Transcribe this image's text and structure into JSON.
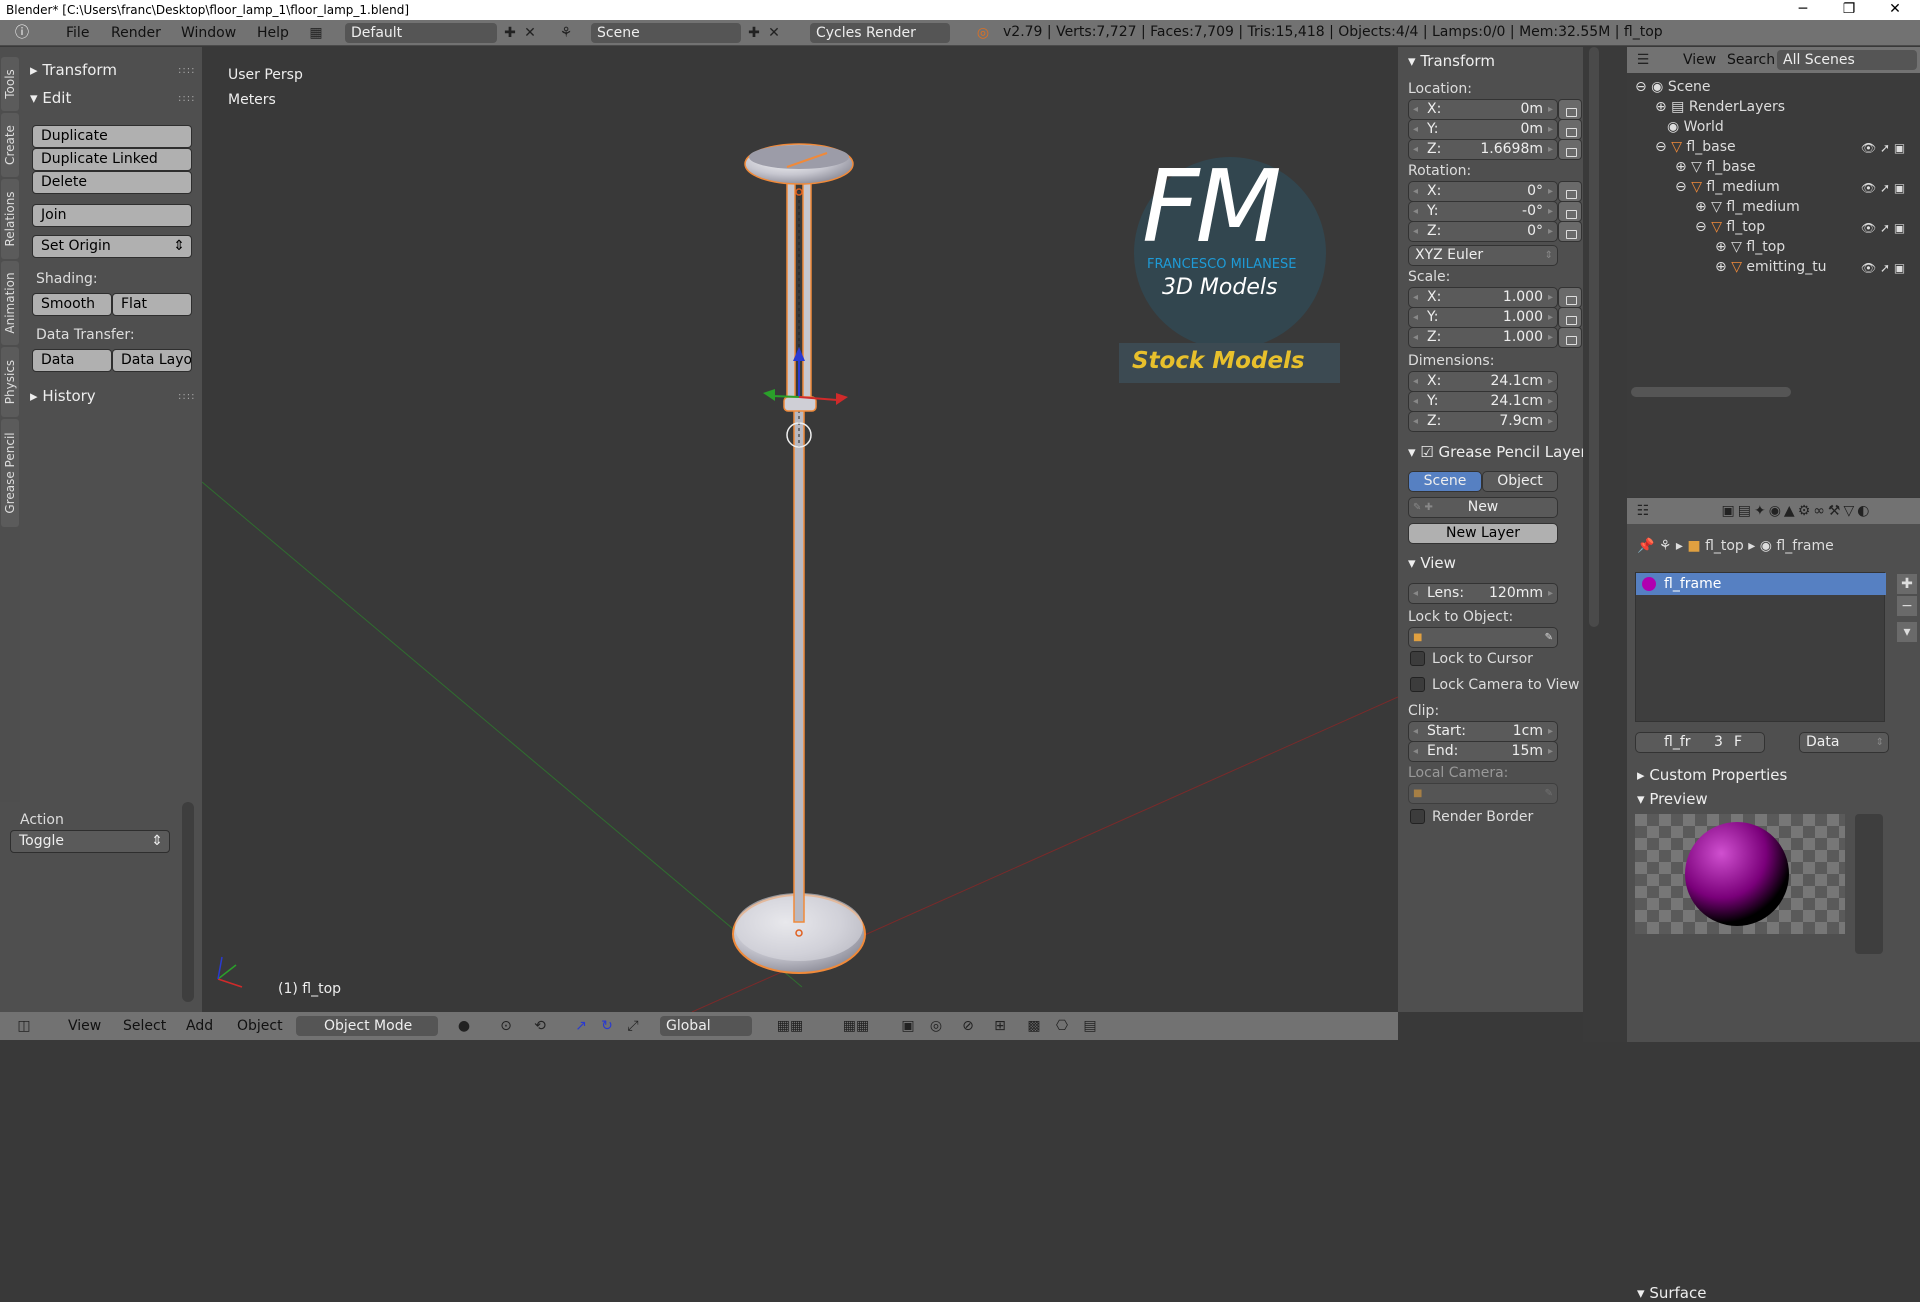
{
  "window": {
    "title": "Blender* [C:\\Users\\franc\\Desktop\\floor_lamp_1\\floor_lamp_1.blend]",
    "minimize": "─",
    "maximize": "❐",
    "close": "✕"
  },
  "topbar": {
    "menus": [
      "File",
      "Render",
      "Window",
      "Help"
    ],
    "layout": "Default",
    "scene": "Scene",
    "engine": "Cycles Render",
    "stats": "v2.79 | Verts:7,727 | Faces:7,709 | Tris:15,418 | Objects:4/4 | Lamps:0/0 | Mem:32.55M | fl_top"
  },
  "lefttabs": [
    "Tools",
    "Create",
    "Relations",
    "Animation",
    "Physics",
    "Grease Pencil"
  ],
  "toolshelf": {
    "transform": "Transform",
    "edit": "Edit",
    "buttons": [
      "Duplicate",
      "Duplicate Linked",
      "Delete"
    ],
    "join": "Join",
    "set_origin": "Set Origin",
    "shading_label": "Shading:",
    "smooth": "Smooth",
    "flat": "Flat",
    "data_transfer_label": "Data Transfer:",
    "data": "Data",
    "data_layo": "Data Layo",
    "history": "History"
  },
  "action": {
    "label": "Action",
    "value": "Toggle"
  },
  "viewport": {
    "view_name": "User Persp",
    "units": "Meters",
    "object_label": "(1) fl_top",
    "logo_letters": "FM",
    "logo_name": "FRANCESCO MILANESE",
    "logo_sub": "3D Models",
    "stock": "Stock Models"
  },
  "bottombar": {
    "view": "View",
    "select": "Select",
    "add": "Add",
    "object": "Object",
    "mode": "Object Mode",
    "orientation": "Global"
  },
  "npanel": {
    "transform": "Transform",
    "location": "Location:",
    "loc": [
      {
        "k": "X:",
        "v": "0m"
      },
      {
        "k": "Y:",
        "v": "0m"
      },
      {
        "k": "Z:",
        "v": "1.6698m"
      }
    ],
    "rotation": "Rotation:",
    "rot": [
      {
        "k": "X:",
        "v": "0°"
      },
      {
        "k": "Y:",
        "v": "-0°"
      },
      {
        "k": "Z:",
        "v": "0°"
      }
    ],
    "euler": "XYZ Euler",
    "scale": "Scale:",
    "scl": [
      {
        "k": "X:",
        "v": "1.000"
      },
      {
        "k": "Y:",
        "v": "1.000"
      },
      {
        "k": "Z:",
        "v": "1.000"
      }
    ],
    "dimensions": "Dimensions:",
    "dim": [
      {
        "k": "X:",
        "v": "24.1cm"
      },
      {
        "k": "Y:",
        "v": "24.1cm"
      },
      {
        "k": "Z:",
        "v": "7.9cm"
      }
    ],
    "gp_layer": "Grease Pencil Layer",
    "scene_btn": "Scene",
    "object_btn": "Object",
    "new_btn": "New",
    "new_layer": "New Layer",
    "view": "View",
    "lens_k": "Lens:",
    "lens_v": "120mm",
    "lock_obj": "Lock to Object:",
    "lock_cursor": "Lock to Cursor",
    "lock_cam": "Lock Camera to View",
    "clip": "Clip:",
    "start_k": "Start:",
    "start_v": "1cm",
    "end_k": "End:",
    "end_v": "15m",
    "local_cam": "Local Camera:",
    "render_border": "Render Border"
  },
  "outliner": {
    "view": "View",
    "search": "Search",
    "all_scenes": "All Scenes",
    "items": [
      {
        "t": "Scene"
      },
      {
        "t": "RenderLayers"
      },
      {
        "t": "World"
      },
      {
        "t": "fl_base"
      },
      {
        "t": "fl_base"
      },
      {
        "t": "fl_medium"
      },
      {
        "t": "fl_medium"
      },
      {
        "t": "fl_top"
      },
      {
        "t": "fl_top"
      },
      {
        "t": "emitting_tu"
      }
    ]
  },
  "props": {
    "crumb_obj": "fl_top",
    "crumb_mat": "fl_frame",
    "slot": "fl_frame",
    "mat_name": "fl_fr",
    "users": "3",
    "fake": "F",
    "data": "Data",
    "custom_props": "Custom Properties",
    "preview": "Preview",
    "surface": "Surface"
  },
  "colors": {
    "accent": "#5680c2",
    "selected_object": "#f08a3a",
    "logo_blue": "#1e9bd7",
    "stock_yellow": "#e8c02c"
  }
}
